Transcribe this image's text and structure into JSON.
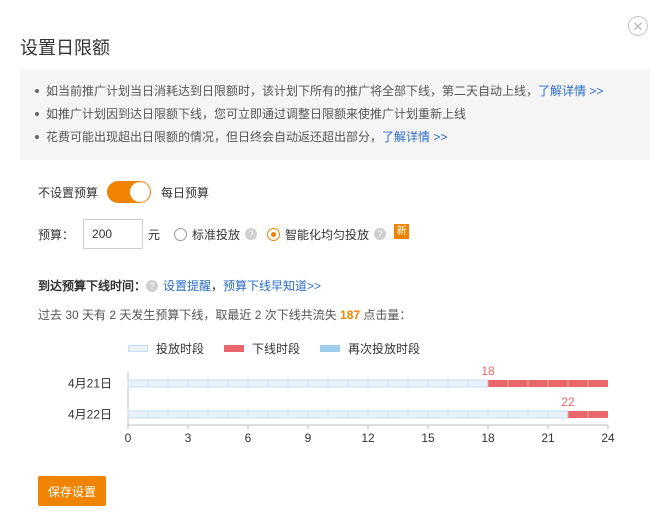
{
  "dialog": {
    "title": "设置日限额",
    "close_glyph": "✕"
  },
  "notice": {
    "lines": [
      {
        "text": "如当前推广计划当日消耗达到日限额时，该计划下所有的推广将全部下线，第二天自动上线，",
        "link": "了解详情 >>"
      },
      {
        "text": "如推广计划因到达日限额下线，您可立即通过调整日限额来使推广计划重新上线",
        "link": ""
      },
      {
        "text": "花费可能出现超出日限额的情况，但日终会自动返还超出部分，",
        "link": "了解详情 >>"
      }
    ]
  },
  "budget_type": {
    "off_label": "不设置预算",
    "on_label": "每日预算",
    "enabled": true
  },
  "budget": {
    "label": "预算：",
    "value": "200",
    "unit": "元",
    "options": [
      {
        "label": "标准投放",
        "checked": false
      },
      {
        "label": "智能化均匀投放",
        "checked": true
      }
    ],
    "new_badge": "新",
    "help_glyph": "?"
  },
  "offline_time": {
    "label": "到达预算下线时间：",
    "link_set": "设置提醒",
    "separator": "，",
    "link_early": "预算下线早知道>>"
  },
  "stats": {
    "prefix": "过去 30 天有 2 天发生预算下线，取最近 2 次下线共流失 ",
    "lost_clicks": "187",
    "suffix": " 点击量："
  },
  "legend": {
    "serve": "投放时段",
    "offline": "下线时段",
    "again": "再次投放时段"
  },
  "chart_data": {
    "type": "bar",
    "x_ticks": [
      0,
      3,
      6,
      9,
      12,
      15,
      18,
      21,
      24
    ],
    "xlim": [
      0,
      24
    ],
    "rows": [
      {
        "date": "4月21日",
        "offline_start": 18,
        "offline_end": 24,
        "label": "18"
      },
      {
        "date": "4月22日",
        "offline_start": 22,
        "offline_end": 24,
        "label": "22"
      }
    ],
    "colors": {
      "serve": "#e8f2fb",
      "serve_border": "#c5ddf0",
      "offline": "#e9676b",
      "axis": "#bfbfbf",
      "label": "#e9676b"
    }
  },
  "actions": {
    "save_label": "保存设置"
  }
}
